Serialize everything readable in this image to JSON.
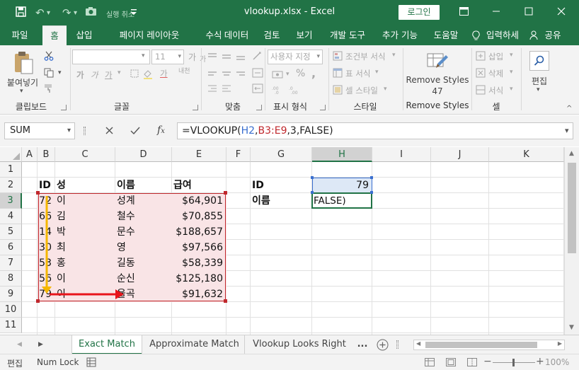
{
  "window": {
    "title": "vlookup.xlsx  -  Excel",
    "login": "로그인",
    "undo_label": "실행 취소",
    "title_icons": [
      "save-icon",
      "undo-icon",
      "redo-icon",
      "camera-icon",
      "dropdown-icon"
    ]
  },
  "ribbon_tabs": [
    {
      "label": "파일"
    },
    {
      "label": "홈"
    },
    {
      "label": "삽입"
    },
    {
      "label": "페이지 레이아웃"
    },
    {
      "label": "수식"
    },
    {
      "label": "데이터"
    },
    {
      "label": "검토"
    },
    {
      "label": "보기"
    },
    {
      "label": "개발 도구"
    },
    {
      "label": "추가 기능"
    },
    {
      "label": "도움말"
    },
    {
      "label": "입력하세"
    },
    {
      "label": "공유"
    }
  ],
  "ribbon": {
    "clipboard": {
      "paste": "붙여넣기",
      "group": "클립보드"
    },
    "font": {
      "size": "11",
      "group": "글꼴",
      "bold": "가",
      "italic": "가",
      "underline": "가",
      "grow": "가",
      "shrink": "가",
      "phonetic": "내천"
    },
    "alignment": {
      "group": "맞춤"
    },
    "number": {
      "format": "사용자 지정",
      "group": "표시 형식",
      "percent": "%",
      "comma": ","
    },
    "styles": {
      "group": "스타일",
      "conditional": "조건부 서식",
      "table": "표 서식",
      "cell": "셀 스타일"
    },
    "remove_styles": {
      "label": "Remove Styles",
      "count": "47",
      "group": "Remove Styles"
    },
    "cells": {
      "group": "셀",
      "insert": "삽입",
      "delete": "삭제",
      "format": "서식"
    },
    "editing": {
      "label": "편집"
    }
  },
  "formula_bar": {
    "name_box": "SUM",
    "formula_parts": [
      {
        "text": "=VLOOKUP(",
        "color": "#222222"
      },
      {
        "text": "H2",
        "color": "#3a6fcf"
      },
      {
        "text": ",",
        "color": "#222222"
      },
      {
        "text": "B3:E9",
        "color": "#c0282d"
      },
      {
        "text": ",3,FALSE)",
        "color": "#222222"
      }
    ]
  },
  "columns": [
    "A",
    "B",
    "C",
    "D",
    "E",
    "F",
    "G",
    "H",
    "I",
    "J",
    "K"
  ],
  "rows": [
    "1",
    "2",
    "3",
    "4",
    "5",
    "6",
    "7",
    "8",
    "9",
    "10",
    "11"
  ],
  "sheet": {
    "headers": {
      "id": "ID",
      "last": "성",
      "first": "이름",
      "salary": "급여"
    },
    "table": [
      {
        "id": "72",
        "last": "이",
        "first": "성계",
        "salary": "$64,901"
      },
      {
        "id": "66",
        "last": "김",
        "first": "철수",
        "salary": "$70,855"
      },
      {
        "id": "14",
        "last": "박",
        "first": "문수",
        "salary": "$188,657"
      },
      {
        "id": "30",
        "last": "최",
        "first": "영",
        "salary": "$97,566"
      },
      {
        "id": "53",
        "last": "홍",
        "first": "길동",
        "salary": "$58,339"
      },
      {
        "id": "56",
        "last": "이",
        "first": "순신",
        "salary": "$125,180"
      },
      {
        "id": "79",
        "last": "이",
        "first": "율곡",
        "salary": "$91,632"
      }
    ],
    "lookup": {
      "id_label": "ID",
      "id_value": "79",
      "name_label": "이름",
      "name_value": "FALSE)"
    }
  },
  "sheet_tabs": [
    {
      "label": "Exact Match"
    },
    {
      "label": "Approximate Match"
    },
    {
      "label": "Vlookup Looks Right"
    }
  ],
  "sheet_tabs_more": "...",
  "status": {
    "mode": "편집",
    "numlock": "Num Lock",
    "zoom": "100%"
  },
  "colors": {
    "accent": "#217346",
    "table_fill": "#f9e4e6",
    "table_border": "#c0282d",
    "lookup_fill": "#dde8f6",
    "arrow_down": "#f5b700",
    "arrow_right": "#e8141b"
  }
}
